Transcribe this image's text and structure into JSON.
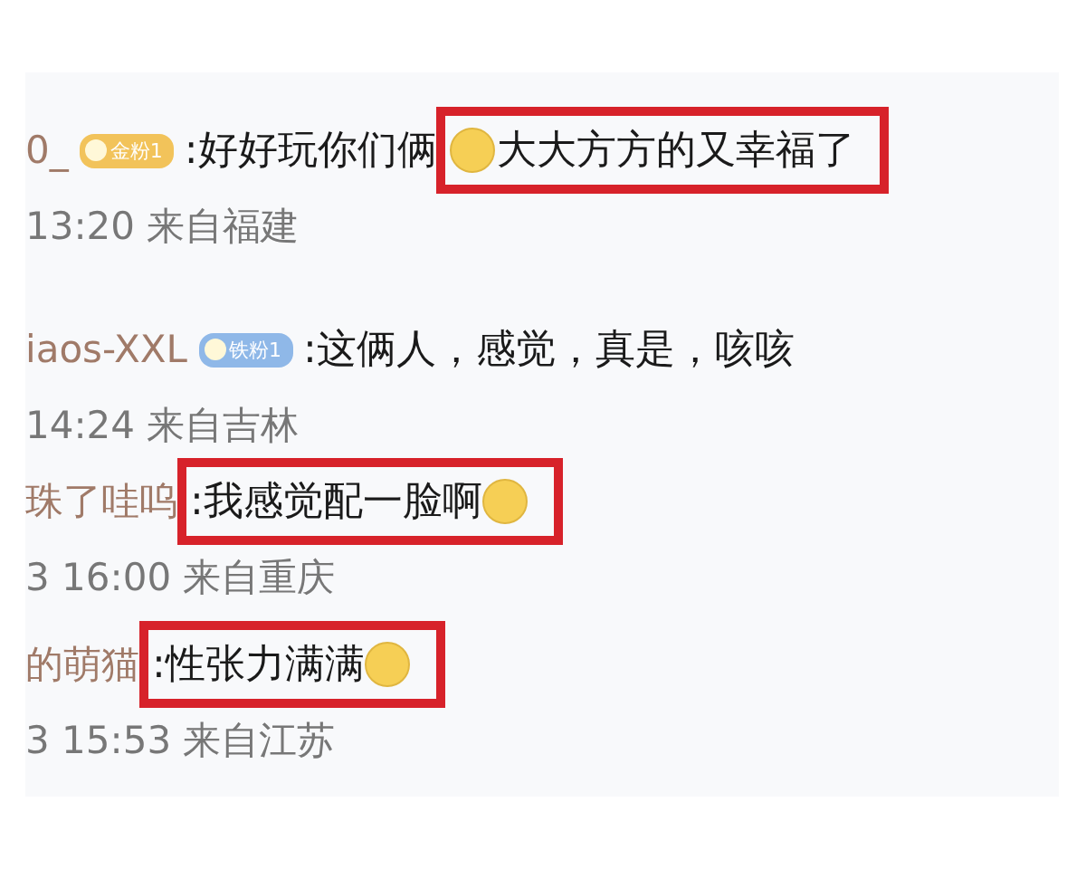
{
  "comments": [
    {
      "user": "0_",
      "badge": {
        "label": "金粉1",
        "color": "#f2c35a"
      },
      "plain": [
        {
          "kind": "text",
          "text": ":好好玩你们俩"
        }
      ],
      "boxed": [
        {
          "kind": "emoji"
        },
        {
          "kind": "text",
          "text": "大大方方的又幸福了"
        }
      ],
      "meta": "13:20 来自福建"
    },
    {
      "user": "iaos-XXL",
      "badge": {
        "label": "铁粉1",
        "color": "#8fb8e8"
      },
      "plain": [
        {
          "kind": "text",
          "text": ":这俩人，感觉，真是，咳咳"
        }
      ],
      "meta": "14:24 来自吉林"
    },
    {
      "user": "珠了哇呜",
      "boxed": [
        {
          "kind": "text",
          "text": ":我感觉配一脸啊"
        },
        {
          "kind": "emoji"
        }
      ],
      "meta": "3 16:00 来自重庆"
    },
    {
      "user": "的萌猫",
      "boxed": [
        {
          "kind": "text",
          "text": ":性张力满满"
        },
        {
          "kind": "emoji"
        }
      ],
      "meta": "3 15:53 来自江苏"
    }
  ]
}
